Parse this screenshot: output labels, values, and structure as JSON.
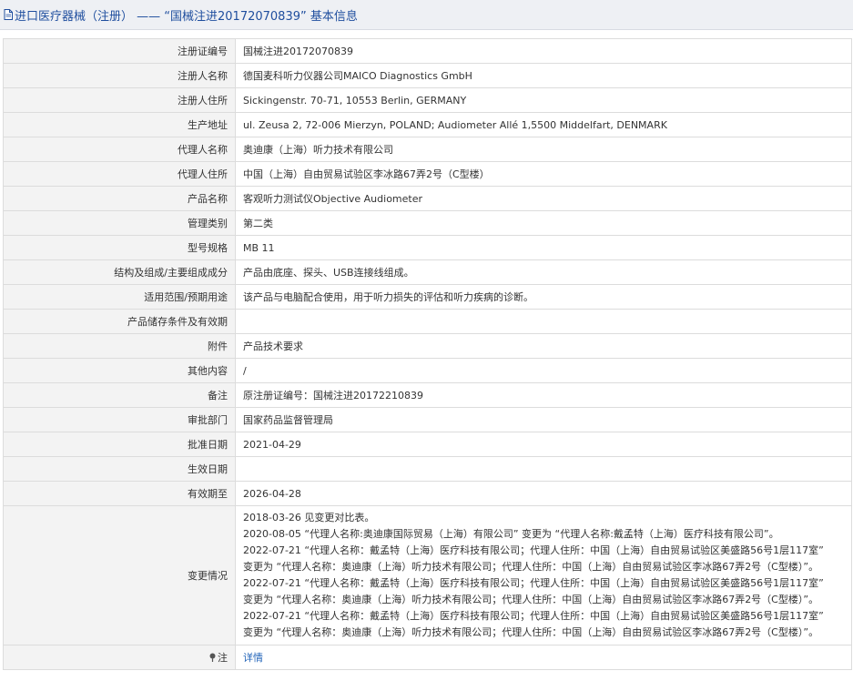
{
  "header": {
    "title": "进口医疗器械（注册） —— “国械注进20172070839” 基本信息"
  },
  "fields": [
    {
      "label": "注册证编号",
      "value": "国械注进20172070839"
    },
    {
      "label": "注册人名称",
      "value": "德国麦科听力仪器公司MAICO Diagnostics GmbH"
    },
    {
      "label": "注册人住所",
      "value": "Sickingenstr. 70-71, 10553 Berlin, GERMANY"
    },
    {
      "label": "生产地址",
      "value": "ul. Zeusa 2, 72-006 Mierzyn, POLAND; Audiometer Allé 1,5500 Middelfart, DENMARK"
    },
    {
      "label": "代理人名称",
      "value": "奥迪康（上海）听力技术有限公司"
    },
    {
      "label": "代理人住所",
      "value": "中国（上海）自由贸易试验区李冰路67弄2号（C型楼）"
    },
    {
      "label": "产品名称",
      "value": "客观听力测试仪Objective Audiometer"
    },
    {
      "label": "管理类别",
      "value": "第二类"
    },
    {
      "label": "型号规格",
      "value": "MB 11"
    },
    {
      "label": "结构及组成/主要组成成分",
      "value": "产品由底座、探头、USB连接线组成。"
    },
    {
      "label": "适用范围/预期用途",
      "value": "该产品与电脑配合使用，用于听力损失的评估和听力疾病的诊断。"
    },
    {
      "label": "产品储存条件及有效期",
      "value": ""
    },
    {
      "label": "附件",
      "value": "产品技术要求"
    },
    {
      "label": "其他内容",
      "value": "/"
    },
    {
      "label": "备注",
      "value": "原注册证编号：国械注进20172210839"
    },
    {
      "label": "审批部门",
      "value": "国家药品监督管理局"
    },
    {
      "label": "批准日期",
      "value": "2021-04-29"
    },
    {
      "label": "生效日期",
      "value": ""
    },
    {
      "label": "有效期至",
      "value": "2026-04-28"
    }
  ],
  "changes": {
    "label": "变更情况",
    "lines": [
      "2018-03-26 见变更对比表。",
      "2020-08-05 “代理人名称:奥迪康国际贸易（上海）有限公司” 变更为 “代理人名称:戴孟特（上海）医疗科技有限公司”。",
      "2022-07-21 “代理人名称：戴孟特（上海）医疗科技有限公司；代理人住所：中国（上海）自由贸易试验区美盛路56号1层117室”",
      "变更为 “代理人名称：奥迪康（上海）听力技术有限公司；代理人住所：中国（上海）自由贸易试验区李冰路67弄2号（C型楼）”。",
      "2022-07-21 “代理人名称：戴孟特（上海）医疗科技有限公司；代理人住所：中国（上海）自由贸易试验区美盛路56号1层117室”",
      "变更为 “代理人名称：奥迪康（上海）听力技术有限公司；代理人住所：中国（上海）自由贸易试验区李冰路67弄2号（C型楼）”。",
      "2022-07-21 “代理人名称：戴孟特（上海）医疗科技有限公司；代理人住所：中国（上海）自由贸易试验区美盛路56号1层117室”",
      "变更为 “代理人名称：奥迪康（上海）听力技术有限公司；代理人住所：中国（上海）自由贸易试验区李冰路67弄2号（C型楼）”。"
    ]
  },
  "note_row": {
    "label": "注",
    "link_text": "详情"
  },
  "colors": {
    "title": "#1f4e9e",
    "link": "#1f62b8",
    "label_bg": "#f3f3f3",
    "border": "#dcdcdc"
  },
  "icons": {
    "title": "document-icon",
    "note": "pin-icon"
  }
}
